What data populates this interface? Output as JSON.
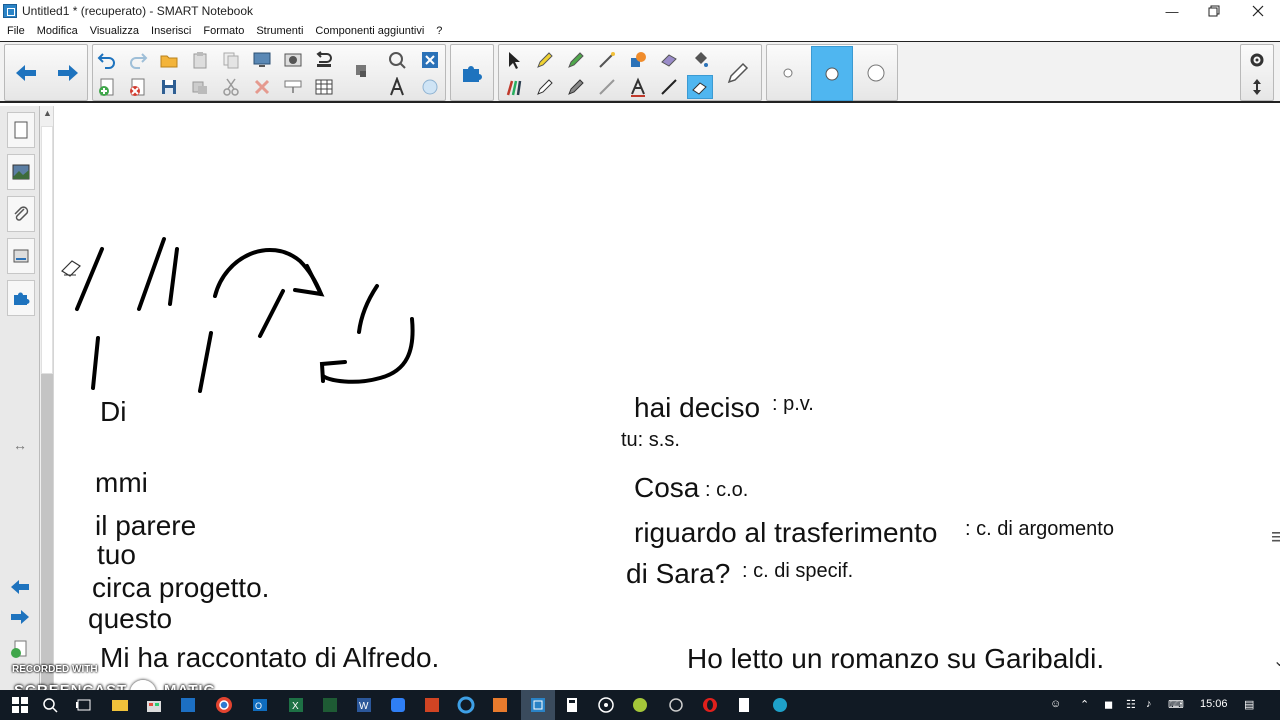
{
  "window": {
    "title": "Untitled1 * (recuperato) - SMART Notebook",
    "minimize_icon": "minimize-icon",
    "restore_icon": "restore-icon",
    "close_icon": "close-icon"
  },
  "menu": {
    "items": [
      "File",
      "Modifica",
      "Visualizza",
      "Inserisci",
      "Formato",
      "Strumenti",
      "Componenti aggiuntivi",
      "?"
    ]
  },
  "toolbar": {
    "icons": [
      "back-arrow-icon",
      "forward-arrow-icon",
      "undo-icon",
      "redo-icon",
      "open-folder-icon",
      "paste-icon",
      "duplicate-icon",
      "screen-capture-icon",
      "document-camera-icon",
      "screen-shade-icon",
      "spell-check-icon",
      "delete-icon",
      "add-page-icon",
      "clear-page-icon",
      "save-icon",
      "move-icon",
      "cut-icon",
      "x-delete-icon",
      "table-icon",
      "fill-icon",
      "addon-puzzle-icon",
      "select-arrow-icon",
      "pen-icon",
      "creative-pen-icon",
      "magic-pen-icon",
      "shape-icon",
      "eraser-icon",
      "fill-bucket-icon",
      "line-icon",
      "text-icon",
      "settings-gear-icon",
      "toolbar-move-icon"
    ],
    "active_tool": "eraser-icon",
    "accent_color": "#4fb6f0"
  },
  "side_panel": {
    "tabs": [
      "page-sorter-icon",
      "gallery-icon",
      "attachments-icon",
      "properties-icon",
      "addons-icon"
    ],
    "nav_icons": [
      "prev-page-icon",
      "next-page-icon",
      "add-page-icon"
    ]
  },
  "canvas": {
    "left_column": {
      "line1": "Di",
      "line2": "mmi",
      "line3": "il parere",
      "line4": "tuo",
      "line5": "circa progetto.",
      "line6": "questo",
      "sentence": "Mi ha raccontato di Alfredo."
    },
    "right_column": {
      "verb": "hai deciso",
      "verb_label": ": p.v.",
      "subject_label": "tu: s.s.",
      "object": "Cosa",
      "object_label": ": c.o.",
      "argument": "riguardo al trasferimento",
      "argument_label": ": c. di argomento",
      "specification": "di Sara?",
      "specification_label": ": c. di specif.",
      "sentence": "Ho letto un romanzo su Garibaldi."
    }
  },
  "watermark": {
    "top": "RECORDED WITH",
    "bottom": "SCREENCAST",
    "bottom2": "MATIC"
  },
  "taskbar": {
    "time": "15:06",
    "icons": [
      "start-icon",
      "search-icon",
      "task-view-icon",
      "file-explorer-icon",
      "store-icon",
      "chrome-icon",
      "outlook-icon",
      "excel-icon",
      "word-icon",
      "dropbox-icon",
      "powerpoint-icon",
      "edge-icon",
      "smart-notebook-icon",
      "calculator-icon",
      "media-icon",
      "android-icon",
      "network-icon",
      "opera-icon",
      "notepad-icon",
      "web-icon"
    ]
  }
}
